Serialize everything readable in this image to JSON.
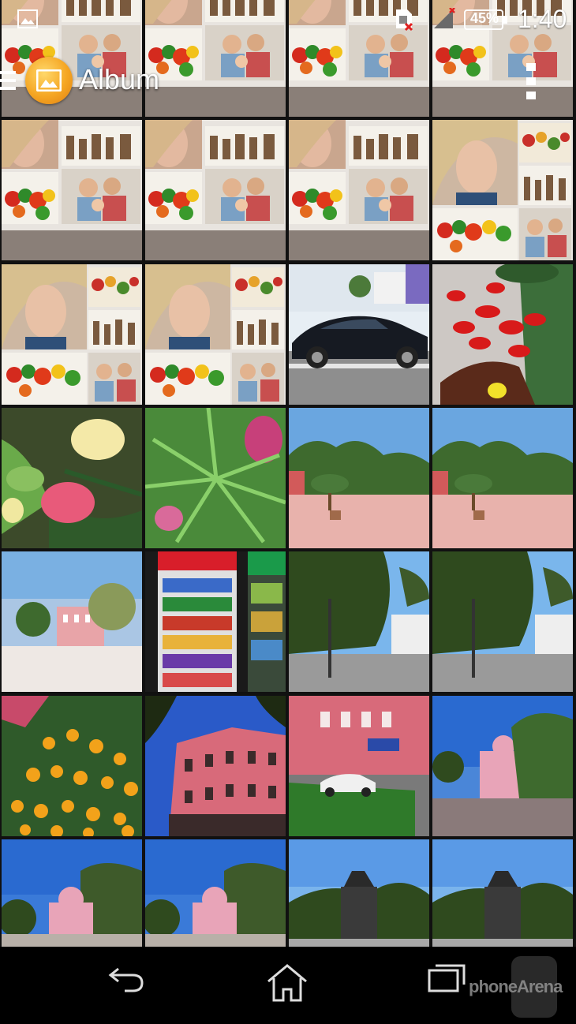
{
  "status_bar": {
    "battery": "45%",
    "time": "1:40"
  },
  "action_bar": {
    "title": "Album",
    "icons": [
      "menu-icon",
      "album-app-icon",
      "overflow-menu-icon"
    ]
  },
  "grid": {
    "columns": 4,
    "photos": [
      "collage",
      "collage",
      "collage",
      "collage",
      "collage",
      "collage",
      "collage",
      "collage-portrait",
      "collage-portrait",
      "collage-portrait",
      "car",
      "peppers",
      "flowers-leaves",
      "oleander-leaves",
      "square-palms",
      "square-palms",
      "square-building",
      "drinks-fridge",
      "trees-street",
      "trees-street",
      "marigolds",
      "pink-building",
      "hotel-car",
      "square-theatre",
      "theatre",
      "theatre",
      "monument",
      "monument"
    ]
  },
  "nav_bar": {
    "icons": [
      "back-icon",
      "home-icon",
      "recent-apps-icon"
    ]
  },
  "watermark": "phoneArena"
}
